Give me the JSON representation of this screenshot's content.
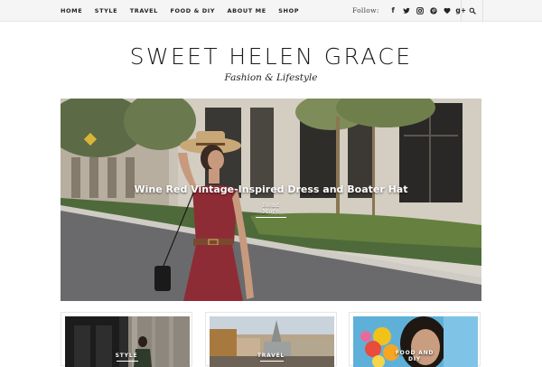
{
  "nav": {
    "items": [
      "HOME",
      "STYLE",
      "TRAVEL",
      "FOOD & DIY",
      "ABOUT ME",
      "SHOP"
    ]
  },
  "follow": {
    "label": "Follow:",
    "icons": [
      "facebook-icon",
      "twitter-icon",
      "instagram-icon",
      "pinterest-icon",
      "bloglovin-heart-icon",
      "google-plus-icon"
    ],
    "facebook_glyph": "f",
    "googleplus_glyph": "g+"
  },
  "search": {
    "icon": "search-icon"
  },
  "header": {
    "title": "SWEET HELEN GRACE",
    "tagline": "Fashion & Lifestyle"
  },
  "hero": {
    "title": "Wine Red Vintage-Inspired Dress and Boater Hat",
    "read_more_line1": "Read",
    "read_more_line2": "More"
  },
  "cards": [
    {
      "category": "STYLE"
    },
    {
      "category": "TRAVEL"
    },
    {
      "category_line1": "FOOD AND",
      "category_line2": "DIY"
    }
  ],
  "colors": {
    "topbar_bg": "#f5f5f5",
    "text": "#222222",
    "dress": "#8e2c35"
  }
}
